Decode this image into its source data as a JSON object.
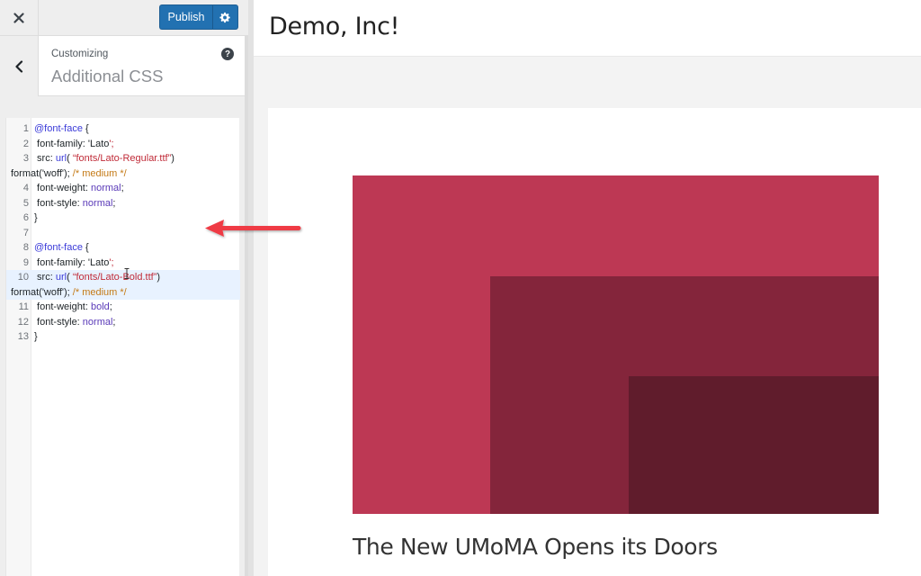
{
  "sidebar": {
    "close_label": "Close",
    "publish_label": "Publish",
    "publish_settings_label": "Publish Settings",
    "section": {
      "breadcrumb": "Customizing",
      "title": "Additional CSS",
      "help_label": "?"
    }
  },
  "editor": {
    "lines": [
      {
        "num": "1",
        "parts": [
          {
            "t": "@font-face",
            "c": "kw"
          },
          {
            "t": " {",
            "c": ""
          }
        ]
      },
      {
        "num": "2",
        "parts": [
          {
            "t": " font-family: 'Lato",
            "c": ""
          },
          {
            "t": "';",
            "c": "str"
          }
        ]
      },
      {
        "num": "3",
        "parts": [
          {
            "t": " src: ",
            "c": ""
          },
          {
            "t": "url",
            "c": "kw"
          },
          {
            "t": "( ",
            "c": ""
          },
          {
            "t": "“fonts/Lato-Regular.ttf”",
            "c": "str"
          },
          {
            "t": ")",
            "c": ""
          }
        ]
      },
      {
        "num": "",
        "parts": [
          {
            "t": "format('woff'); ",
            "c": ""
          },
          {
            "t": "/* medium */",
            "c": "cm"
          }
        ]
      },
      {
        "num": "4",
        "parts": [
          {
            "t": " font-weight: ",
            "c": ""
          },
          {
            "t": "normal",
            "c": "val"
          },
          {
            "t": ";",
            "c": ""
          }
        ]
      },
      {
        "num": "5",
        "parts": [
          {
            "t": " font-style: ",
            "c": ""
          },
          {
            "t": "normal",
            "c": "val"
          },
          {
            "t": ";",
            "c": ""
          }
        ]
      },
      {
        "num": "6",
        "parts": [
          {
            "t": "}",
            "c": ""
          }
        ]
      },
      {
        "num": "7",
        "parts": []
      },
      {
        "num": "8",
        "parts": [
          {
            "t": "@font-face",
            "c": "kw"
          },
          {
            "t": " {",
            "c": ""
          }
        ]
      },
      {
        "num": "9",
        "parts": [
          {
            "t": " font-family: 'Lato",
            "c": ""
          },
          {
            "t": "';",
            "c": "str"
          }
        ]
      },
      {
        "num": "10",
        "hl": true,
        "parts": [
          {
            "t": " src: ",
            "c": ""
          },
          {
            "t": "url",
            "c": "kw"
          },
          {
            "t": "( ",
            "c": ""
          },
          {
            "t": "“fonts/Lato-Bold.ttf”",
            "c": "str"
          },
          {
            "t": ")",
            "c": ""
          }
        ]
      },
      {
        "num": "",
        "hl": true,
        "parts": [
          {
            "t": "format('woff'); ",
            "c": ""
          },
          {
            "t": "/* medium */",
            "c": "cm"
          }
        ]
      },
      {
        "num": "11",
        "parts": [
          {
            "t": " font-weight: ",
            "c": ""
          },
          {
            "t": "bold",
            "c": "val"
          },
          {
            "t": ";",
            "c": ""
          }
        ]
      },
      {
        "num": "12",
        "parts": [
          {
            "t": " font-style: ",
            "c": ""
          },
          {
            "t": "normal",
            "c": "val"
          },
          {
            "t": ";",
            "c": ""
          }
        ]
      },
      {
        "num": "13",
        "parts": [
          {
            "t": "}",
            "c": ""
          }
        ]
      }
    ]
  },
  "preview": {
    "site_title": "Demo, Inc!",
    "post_title": "The New UMoMA Opens its Doors",
    "hero_colors": {
      "outer": "#bd3854",
      "middle": "#84253b",
      "inner": "#601c2c"
    }
  },
  "annotation": {
    "arrow_color": "#ef3a45"
  },
  "colors": {
    "accent": "#2271b1"
  }
}
